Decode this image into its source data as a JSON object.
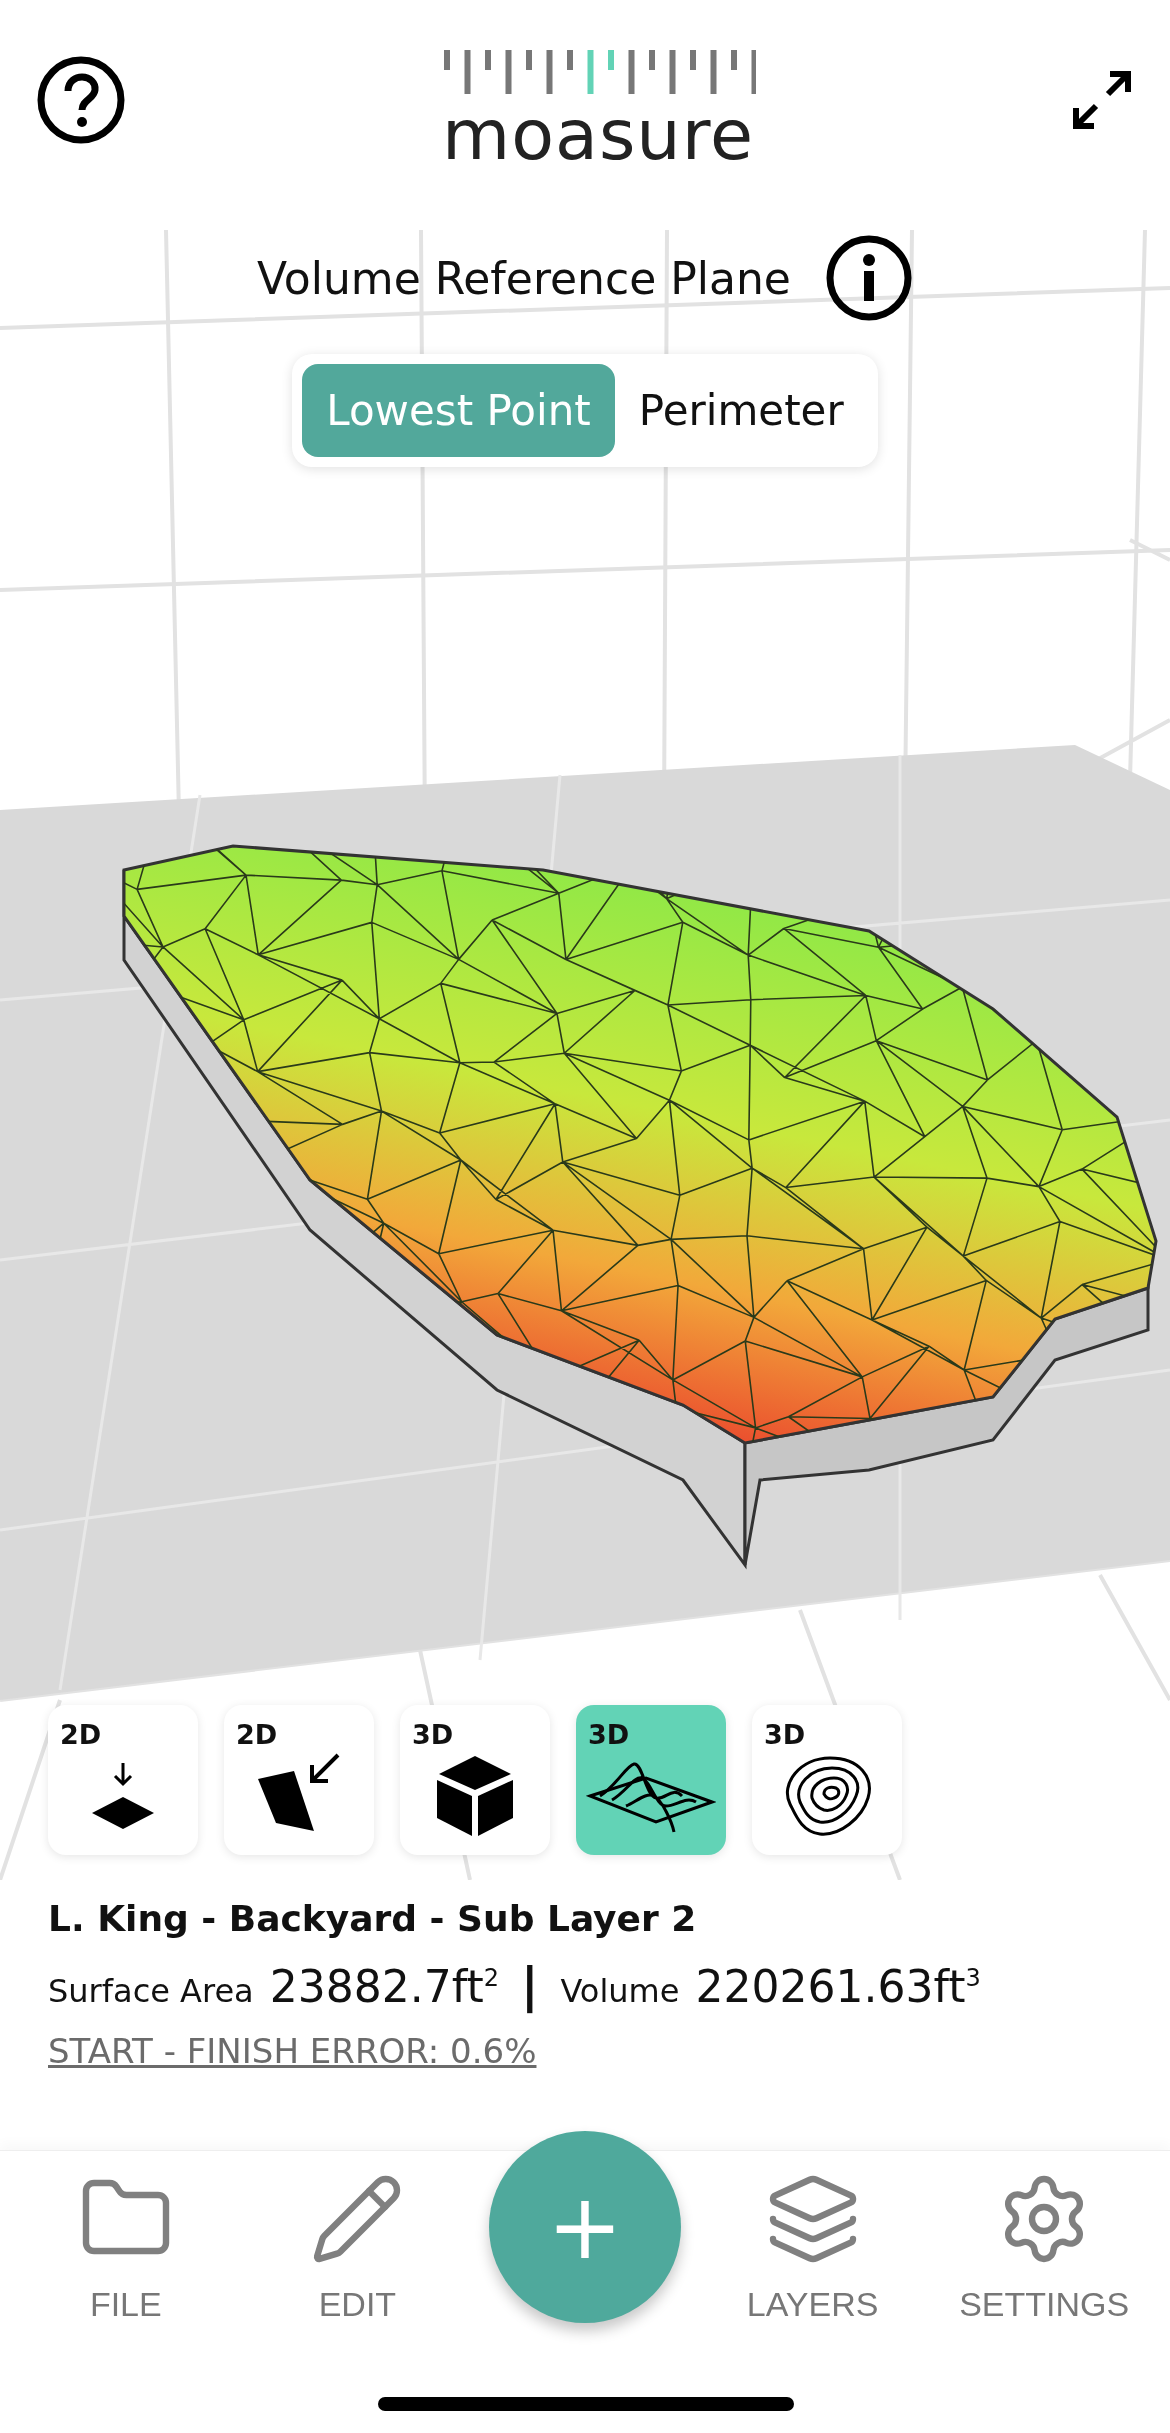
{
  "header": {
    "logo": "moasure"
  },
  "reference_plane": {
    "title": "Volume Reference Plane",
    "options": [
      {
        "label": "Lowest Point",
        "selected": true
      },
      {
        "label": "Perimeter",
        "selected": false
      }
    ]
  },
  "view_modes": [
    {
      "dim": "2D",
      "kind": "plan",
      "selected": false
    },
    {
      "dim": "2D",
      "kind": "elevation",
      "selected": false
    },
    {
      "dim": "3D",
      "kind": "cube",
      "selected": false
    },
    {
      "dim": "3D",
      "kind": "terrain",
      "selected": true
    },
    {
      "dim": "3D",
      "kind": "contour",
      "selected": false
    }
  ],
  "info": {
    "name": "L. King - Backyard - Sub Layer 2",
    "metrics": [
      {
        "label": "Surface Area",
        "value": "23882.7ft$^{2}$"
      },
      {
        "label": "Volume",
        "value": "220261.63ft$^{3}$"
      }
    ],
    "separator": "|",
    "error_link": "START - FINISH ERROR: 0.6%"
  },
  "nav": [
    {
      "kind": "file",
      "label": "FILE"
    },
    {
      "kind": "edit",
      "label": "EDIT"
    },
    {
      "kind": "add",
      "label": "+"
    },
    {
      "kind": "layers",
      "label": "LAYERS"
    },
    {
      "kind": "settings",
      "label": "SETTINGS"
    }
  ]
}
